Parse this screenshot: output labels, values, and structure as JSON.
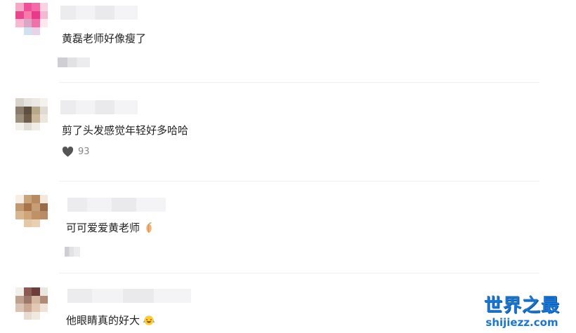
{
  "comments": [
    {
      "text": "黄磊老师好像瘦了",
      "likes": ""
    },
    {
      "text": "剪了头发感觉年轻好多哈哈",
      "likes": "93"
    },
    {
      "text": "可可爱爱黄老师",
      "emoji": "peach-emoji",
      "likes": ""
    },
    {
      "text": "他眼睛真的好大",
      "emoji": "crying-laughing-emoji",
      "likes": ""
    }
  ],
  "watermark": {
    "title": "世界之最",
    "url": "shijiezz.com"
  },
  "colors": {
    "watermark_blue": "#1976d2",
    "like_icon": "#555555"
  }
}
